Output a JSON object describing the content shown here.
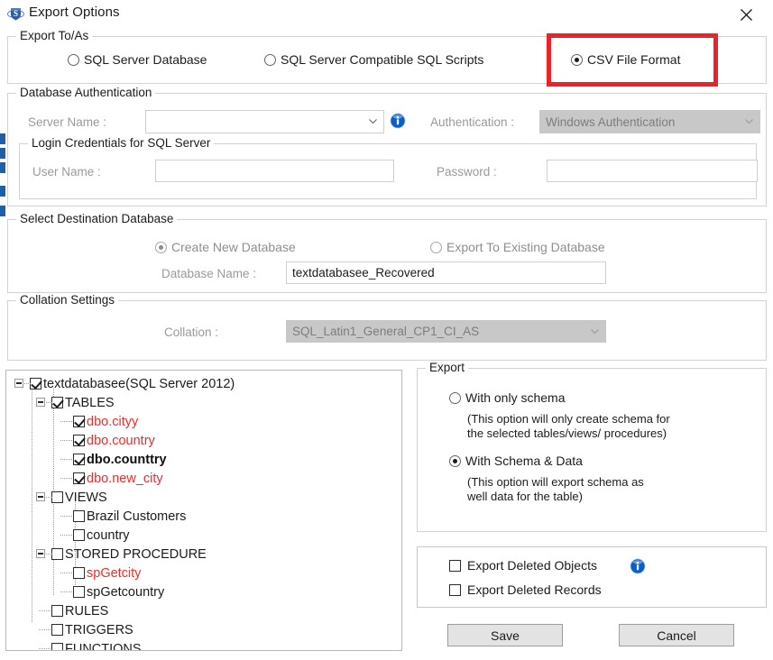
{
  "window": {
    "title": "Export Options",
    "app_icon": "shield-s-icon",
    "close_icon": "close-icon"
  },
  "export_to_as": {
    "legend": "Export To/As",
    "options": [
      {
        "label": "SQL Server Database",
        "selected": false
      },
      {
        "label": "SQL Server Compatible SQL Scripts",
        "selected": false
      },
      {
        "label": "CSV File Format",
        "selected": true
      }
    ],
    "highlight_color": "#e8232a",
    "highlighted_option": "CSV File Format"
  },
  "database_authentication": {
    "legend": "Database Authentication",
    "server_name_label": "Server Name :",
    "server_name_value": "",
    "server_name_placeholder": "",
    "info_icon": "info-icon",
    "authentication_label": "Authentication :",
    "authentication_value": "Windows Authentication",
    "authentication_disabled": true
  },
  "login_credentials": {
    "legend": "Login Credentials for SQL Server",
    "user_name_label": "User Name :",
    "user_name_value": "",
    "password_label": "Password :",
    "password_value": ""
  },
  "destination_database": {
    "legend": "Select Destination Database",
    "options": [
      {
        "label": "Create New Database",
        "selected": true,
        "disabled": true
      },
      {
        "label": "Export To Existing Database",
        "selected": false,
        "disabled": true
      }
    ],
    "database_name_label": "Database Name :",
    "database_name_value": "textdatabasee_Recovered"
  },
  "collation_settings": {
    "legend": "Collation Settings",
    "collation_label": "Collation :",
    "collation_value": "SQL_Latin1_General_CP1_CI_AS",
    "collation_disabled": true
  },
  "tree": {
    "nodes": [
      {
        "label": "textdatabasee(SQL Server 2012)",
        "level": 0,
        "checked": true,
        "expanded": true,
        "style": "normal"
      },
      {
        "label": "TABLES",
        "level": 1,
        "checked": true,
        "expanded": true,
        "style": "normal"
      },
      {
        "label": "dbo.cityy",
        "level": 2,
        "checked": true,
        "expanded": false,
        "style": "red"
      },
      {
        "label": "dbo.country",
        "level": 2,
        "checked": true,
        "expanded": false,
        "style": "red"
      },
      {
        "label": "dbo.counttry",
        "level": 2,
        "checked": true,
        "expanded": false,
        "style": "selected"
      },
      {
        "label": "dbo.new_city",
        "level": 2,
        "checked": true,
        "expanded": false,
        "style": "red"
      },
      {
        "label": "VIEWS",
        "level": 1,
        "checked": false,
        "expanded": true,
        "style": "normal"
      },
      {
        "label": "Brazil Customers",
        "level": 2,
        "checked": false,
        "expanded": false,
        "style": "normal"
      },
      {
        "label": "country",
        "level": 2,
        "checked": false,
        "expanded": false,
        "style": "normal"
      },
      {
        "label": "STORED PROCEDURE",
        "level": 1,
        "checked": false,
        "expanded": true,
        "style": "normal"
      },
      {
        "label": "spGetcity",
        "level": 2,
        "checked": false,
        "expanded": false,
        "style": "red"
      },
      {
        "label": "spGetcountry",
        "level": 2,
        "checked": false,
        "expanded": false,
        "style": "normal"
      },
      {
        "label": "RULES",
        "level": 1,
        "checked": false,
        "expanded": false,
        "style": "normal"
      },
      {
        "label": "TRIGGERS",
        "level": 1,
        "checked": false,
        "expanded": false,
        "style": "normal"
      },
      {
        "label": "FUNCTIONS",
        "level": 1,
        "checked": false,
        "expanded": false,
        "style": "normal"
      }
    ]
  },
  "export_panel": {
    "legend": "Export",
    "options": [
      {
        "label": "With only schema",
        "selected": false,
        "description": "(This option will only create schema for\nthe  selected tables/views/ procedures)"
      },
      {
        "label": "With Schema & Data",
        "selected": true,
        "description": "(This option will export schema as\nwell data for the table)"
      }
    ]
  },
  "deleted_options": {
    "items": [
      {
        "label": "Export Deleted Objects",
        "checked": false,
        "has_info_icon": true
      },
      {
        "label": "Export Deleted Records",
        "checked": false,
        "has_info_icon": false
      }
    ],
    "info_icon": "info-icon"
  },
  "actions": {
    "save_label": "Save",
    "cancel_label": "Cancel"
  }
}
